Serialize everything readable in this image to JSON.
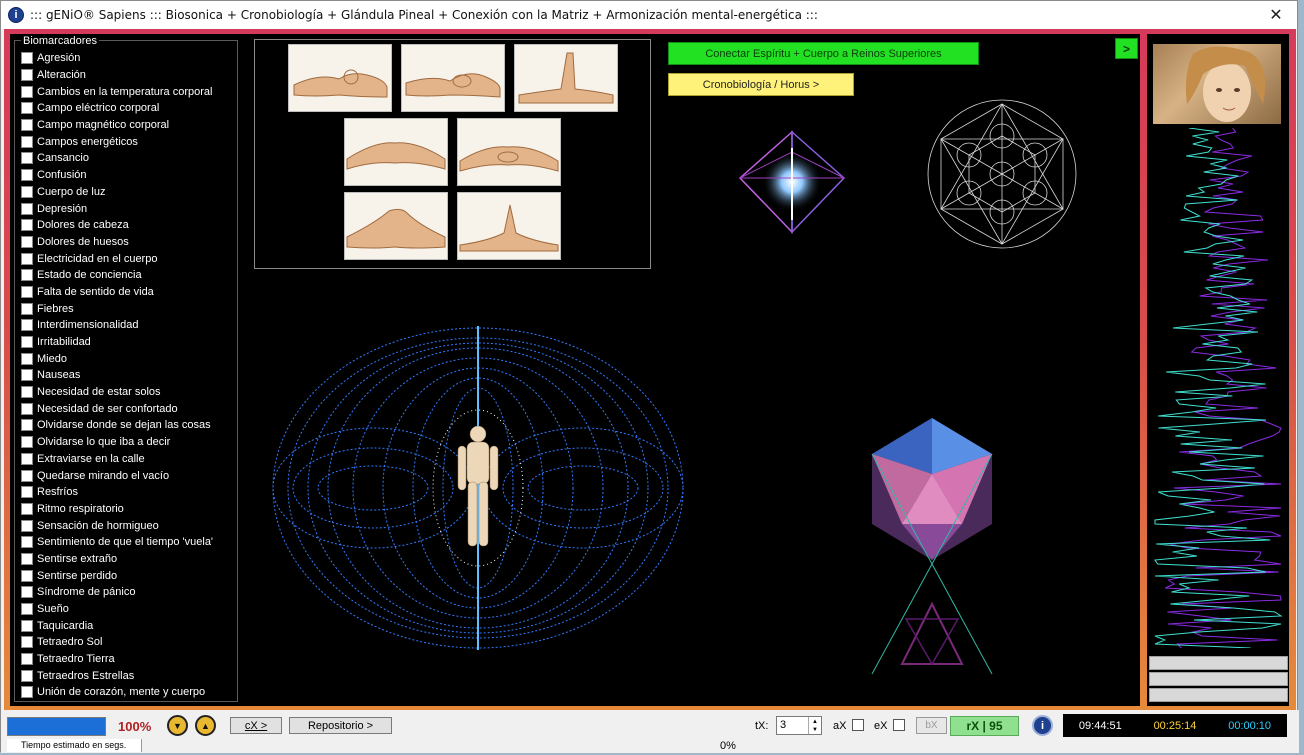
{
  "window": {
    "title": "::: gENiO® Sapiens ::: Biosonica + Cronobiología + Glándula Pineal + Conexión con la Matriz + Armonización mental-energética :::",
    "close_glyph": "✕",
    "app_icon_glyph": "i"
  },
  "biomarkers": {
    "legend": "Biomarcadores",
    "items": [
      "Agresión",
      "Alteración",
      "Cambios en la temperatura corporal",
      "Campo eléctrico corporal",
      "Campo magnético corporal",
      "Campos energéticos",
      "Cansancio",
      "Confusión",
      "Cuerpo de luz",
      "Depresión",
      "Dolores de cabeza",
      "Dolores de huesos",
      "Electricidad en el cuerpo",
      "Estado de conciencia",
      "Falta de sentido de vida",
      "Fiebres",
      "Interdimensionalidad",
      "Irritabilidad",
      "Miedo",
      "Nauseas",
      "Necesidad de estar solos",
      "Necesidad de ser confortado",
      "Olvidarse donde se dejan las cosas",
      "Olvidarse lo que iba a decir",
      "Extraviarse en la calle",
      "Quedarse mirando el vacío",
      "Resfríos",
      "Ritmo respiratorio",
      "Sensación de hormigueo",
      "Sentimiento de que el tiempo 'vuela'",
      "Sentirse extraño",
      "Sentirse perdido",
      "Síndrome de pánico",
      "Sueño",
      "Taquicardia",
      "Tetraedro Sol",
      "Tetraedro Tierra",
      "Tetraedros Estrellas",
      "Unión de corazón, mente y cuerpo"
    ]
  },
  "buttons": {
    "connect": "Conectar Espíritu + Cuerpo a Reinos Superiores",
    "chrono": "Cronobiología / Horus >",
    "next": ">"
  },
  "statusbar": {
    "progress_percent": 100,
    "progress_label": "100%",
    "cx_button": "cX >",
    "repo_button": "Repositorio >",
    "tx_label": "tX:",
    "tx_value": "3",
    "ax_label": "aX",
    "ex_label": "eX",
    "bx_button": "bX",
    "rx_label": "rX | 95",
    "time_1": "09:44:51",
    "time_2": "00:25:14",
    "time_3": "00:00:10",
    "hint": "Tiempo estimado en segs.",
    "bottom_percent": "0%"
  },
  "colors": {
    "accent_green": "#22e022",
    "accent_yellow": "#fff27a",
    "clock_white": "#ffffff",
    "clock_yellow": "#ffd23a",
    "clock_cyan": "#2ad0ff",
    "wave_purple": "#8a2be2",
    "wave_cyan": "#40e0d0"
  }
}
